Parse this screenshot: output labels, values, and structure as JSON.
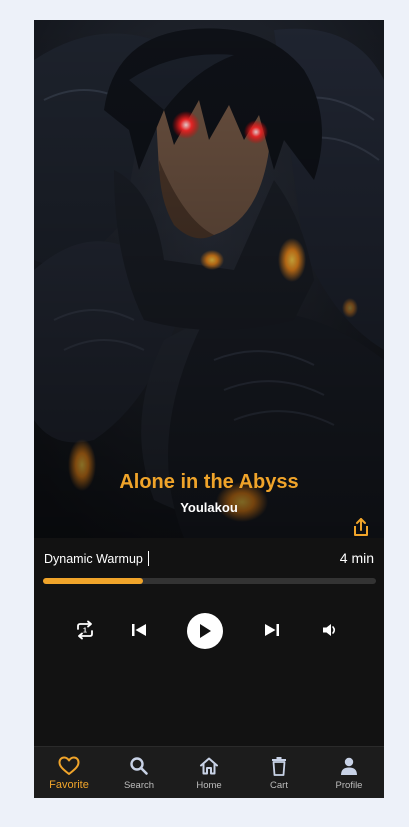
{
  "theme": {
    "accent": "#f0a42a",
    "background": "#121212",
    "page_background": "#edf1f9"
  },
  "now_playing": {
    "title": "Alone in the Abyss",
    "artist": "Youlakou",
    "artwork_icon": "anime-cover-art",
    "share_icon": "share-icon"
  },
  "workout": {
    "name": "Dynamic Warmup",
    "duration": "4 min",
    "progress": 0.3
  },
  "controls": {
    "repeat_icon": "repeat-one-icon",
    "previous_icon": "skip-previous-icon",
    "play_icon": "play-icon",
    "next_icon": "skip-next-icon",
    "volume_icon": "volume-icon"
  },
  "nav": {
    "items": [
      {
        "label": "Favorite",
        "icon": "heart-icon",
        "active": true
      },
      {
        "label": "Search",
        "icon": "search-icon",
        "active": false
      },
      {
        "label": "Home",
        "icon": "home-icon",
        "active": false
      },
      {
        "label": "Cart",
        "icon": "trash-icon",
        "active": false
      },
      {
        "label": "Profile",
        "icon": "person-icon",
        "active": false
      }
    ]
  }
}
